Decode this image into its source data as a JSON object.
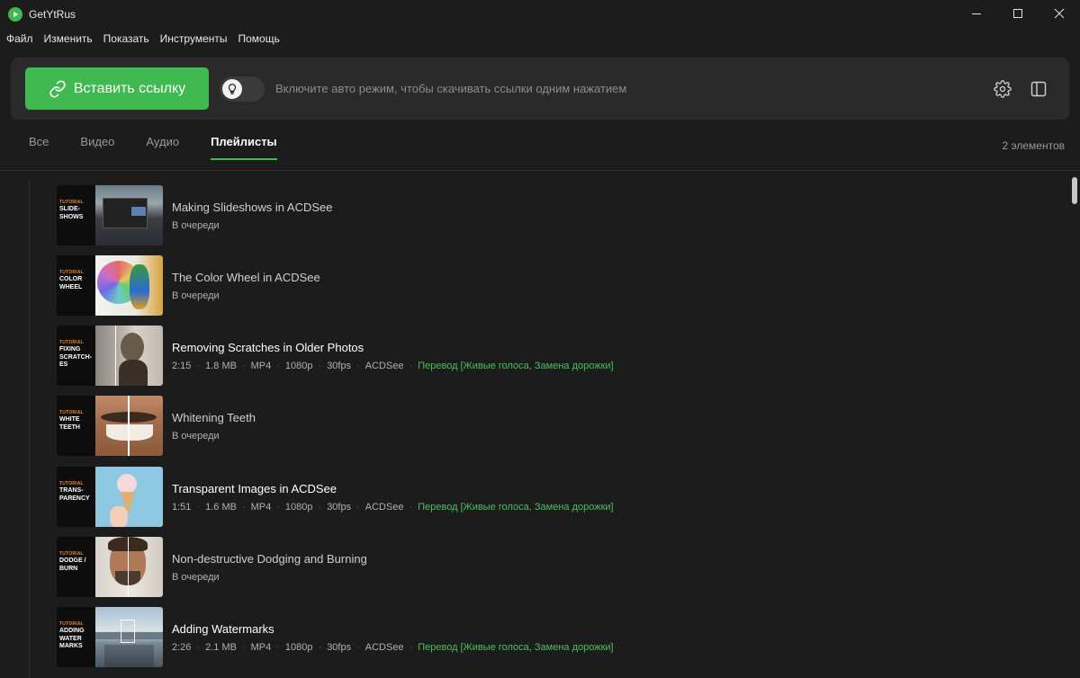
{
  "app": {
    "title": "GetYtRus"
  },
  "menu": [
    "Файл",
    "Изменить",
    "Показать",
    "Инструменты",
    "Помощь"
  ],
  "toolbar": {
    "paste_label": "Вставить ссылку",
    "auto_hint": "Включите авто режим, чтобы скачивать ссылки одним нажатием"
  },
  "tabs": [
    {
      "label": "Все"
    },
    {
      "label": "Видео"
    },
    {
      "label": "Аудио"
    },
    {
      "label": "Плейлисты",
      "active": true
    }
  ],
  "item_count": "2 элементов",
  "accent_color": "#3fb950",
  "items": [
    {
      "title": "Making Slideshows in ACDSee",
      "status": "В очереди",
      "thumb_tag": "TUTORIAL",
      "thumb_text": "SLIDE-SHOWS"
    },
    {
      "title": "The Color Wheel in ACDSee",
      "status": "В очереди",
      "thumb_tag": "TUTORIAL",
      "thumb_text": "COLOR WHEEL"
    },
    {
      "title": "Removing Scratches in Older Photos",
      "thumb_tag": "TUTORIAL",
      "thumb_text": "FIXING SCRATCH-ES",
      "meta": {
        "duration": "2:15",
        "size": "1.8 MB",
        "format": "MP4",
        "resolution": "1080p",
        "fps": "30fps",
        "channel": "ACDSee",
        "extra": "Перевод [Живые голоса, Замена дорожки]"
      }
    },
    {
      "title": "Whitening Teeth",
      "status": "В очереди",
      "thumb_tag": "TUTORIAL",
      "thumb_text": "WHITE TEETH"
    },
    {
      "title": "Transparent Images in ACDSee",
      "thumb_tag": "TUTORIAL",
      "thumb_text": "TRANS-PARENCY",
      "meta": {
        "duration": "1:51",
        "size": "1.6 MB",
        "format": "MP4",
        "resolution": "1080p",
        "fps": "30fps",
        "channel": "ACDSee",
        "extra": "Перевод [Живые голоса, Замена дорожки]"
      }
    },
    {
      "title": "Non-destructive Dodging and Burning",
      "status": "В очереди",
      "thumb_tag": "TUTORIAL",
      "thumb_text": "DODGE / BURN"
    },
    {
      "title": "Adding Watermarks",
      "thumb_tag": "TUTORIAL",
      "thumb_text": "ADDING WATER MARKS",
      "meta": {
        "duration": "2:26",
        "size": "2.1 MB",
        "format": "MP4",
        "resolution": "1080p",
        "fps": "30fps",
        "channel": "ACDSee",
        "extra": "Перевод [Живые голоса, Замена дорожки]"
      }
    }
  ]
}
